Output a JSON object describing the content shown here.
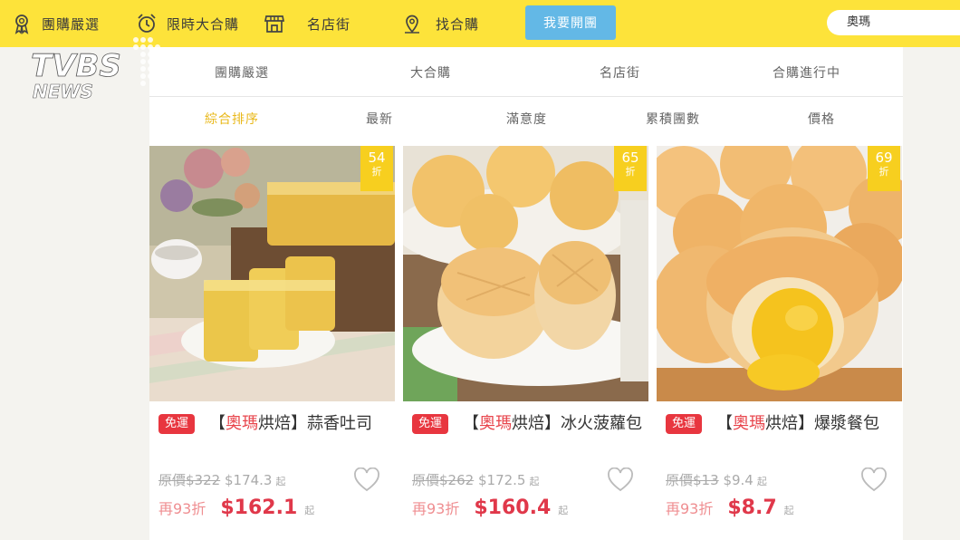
{
  "topnav": {
    "items": [
      {
        "label": "團購嚴選",
        "icon": "medal-icon"
      },
      {
        "label": "限時大合購",
        "icon": "alarm-clock-icon"
      },
      {
        "label": "名店街",
        "icon": "storefront-icon"
      },
      {
        "label": "找合購",
        "icon": "location-pin-icon"
      }
    ],
    "start_button": "我要開團",
    "search_value": "奧瑪"
  },
  "logo": {
    "text_top": "TVBS",
    "text_bottom": "NEWS"
  },
  "categories": [
    "團購嚴選",
    "大合購",
    "名店街",
    "合購進行中"
  ],
  "sort_options": [
    "綜合排序",
    "最新",
    "滿意度",
    "累積團數",
    "價格"
  ],
  "active_sort": "綜合排序",
  "colors": {
    "topbar": "#fde33a",
    "button": "#63b8e6",
    "badge": "#f7cf1f",
    "tag": "#e8363f",
    "price": "#e0384a",
    "active_sort": "#e9b81a"
  },
  "products": [
    {
      "discount_num": "54",
      "discount_unit": "折",
      "tag": "免運",
      "bracket_open": "【",
      "brand": "奧瑪",
      "title_rest": "烘焙】蒜香吐司",
      "orig_label": "原價",
      "orig_price": "$322",
      "group_price": "$174.3",
      "from_label": "起",
      "extra_discount": "再93折",
      "final_price": "$162.1",
      "image": "garlic-toast-photo"
    },
    {
      "discount_num": "65",
      "discount_unit": "折",
      "tag": "免運",
      "bracket_open": "【",
      "brand": "奧瑪",
      "title_rest": "烘焙】冰火菠蘿包",
      "orig_label": "原價",
      "orig_price": "$262",
      "group_price": "$172.5",
      "from_label": "起",
      "extra_discount": "再93折",
      "final_price": "$160.4",
      "image": "pineapple-bun-photo"
    },
    {
      "discount_num": "69",
      "discount_unit": "折",
      "tag": "免運",
      "bracket_open": "【",
      "brand": "奧瑪",
      "title_rest": "烘焙】爆漿餐包",
      "orig_label": "原價",
      "orig_price": "$13",
      "group_price": "$9.4",
      "from_label": "起",
      "extra_discount": "再93折",
      "final_price": "$8.7",
      "image": "custard-bun-photo"
    }
  ]
}
